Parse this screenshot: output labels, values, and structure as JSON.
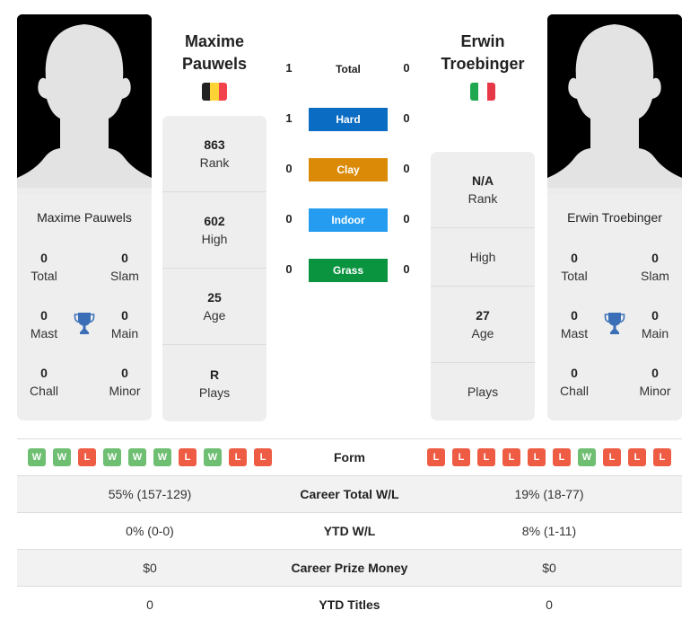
{
  "colors": {
    "hard": "#0a6cc2",
    "clay": "#db8a07",
    "indoor": "#259cf0",
    "grass": "#0b9440",
    "win": "#6fbf73",
    "loss": "#ee5c44",
    "trophy": "#3a6fb8"
  },
  "player1": {
    "name_line1": "Maxime",
    "name_line2": "Pauwels",
    "full_name": "Maxime Pauwels",
    "flag": "belgium-flag",
    "flag_colors": [
      "#222222",
      "#fdd335",
      "#f2424c"
    ],
    "photo": "player-silhouette",
    "titles": {
      "total": {
        "value": "0",
        "label": "Total"
      },
      "slam": {
        "value": "0",
        "label": "Slam"
      },
      "mast": {
        "value": "0",
        "label": "Mast"
      },
      "main": {
        "value": "0",
        "label": "Main"
      },
      "chall": {
        "value": "0",
        "label": "Chall"
      },
      "minor": {
        "value": "0",
        "label": "Minor"
      }
    },
    "stats": [
      {
        "value": "863",
        "label": "Rank"
      },
      {
        "value": "602",
        "label": "High"
      },
      {
        "value": "25",
        "label": "Age"
      },
      {
        "value": "R",
        "label": "Plays"
      }
    ],
    "form": [
      "W",
      "W",
      "L",
      "W",
      "W",
      "W",
      "L",
      "W",
      "L",
      "L"
    ]
  },
  "player2": {
    "name_line1": "Erwin",
    "name_line2": "Troebinger",
    "full_name": "Erwin Troebinger",
    "flag": "italy-flag",
    "flag_colors": [
      "#1fa84f",
      "#ffffff",
      "#e63846"
    ],
    "photo": "player-silhouette",
    "titles": {
      "total": {
        "value": "0",
        "label": "Total"
      },
      "slam": {
        "value": "0",
        "label": "Slam"
      },
      "mast": {
        "value": "0",
        "label": "Mast"
      },
      "main": {
        "value": "0",
        "label": "Main"
      },
      "chall": {
        "value": "0",
        "label": "Chall"
      },
      "minor": {
        "value": "0",
        "label": "Minor"
      }
    },
    "stats": [
      {
        "value": "N/A",
        "label": "Rank"
      },
      {
        "value": "",
        "label": "High"
      },
      {
        "value": "27",
        "label": "Age"
      },
      {
        "value": "",
        "label": "Plays"
      }
    ],
    "form": [
      "L",
      "L",
      "L",
      "L",
      "L",
      "L",
      "W",
      "L",
      "L",
      "L"
    ]
  },
  "h2h": [
    {
      "label": "Total",
      "left": "1",
      "right": "0",
      "surface": "total"
    },
    {
      "label": "Hard",
      "left": "1",
      "right": "0",
      "surface": "hard"
    },
    {
      "label": "Clay",
      "left": "0",
      "right": "0",
      "surface": "clay"
    },
    {
      "label": "Indoor",
      "left": "0",
      "right": "0",
      "surface": "indoor"
    },
    {
      "label": "Grass",
      "left": "0",
      "right": "0",
      "surface": "grass"
    }
  ],
  "comparison": {
    "form_label": "Form",
    "rows": [
      {
        "label": "Career Total W/L",
        "left": "55% (157-129)",
        "right": "19% (18-77)"
      },
      {
        "label": "YTD W/L",
        "left": "0% (0-0)",
        "right": "8% (1-11)"
      },
      {
        "label": "Career Prize Money",
        "left": "$0",
        "right": "$0"
      },
      {
        "label": "YTD Titles",
        "left": "0",
        "right": "0"
      }
    ]
  }
}
